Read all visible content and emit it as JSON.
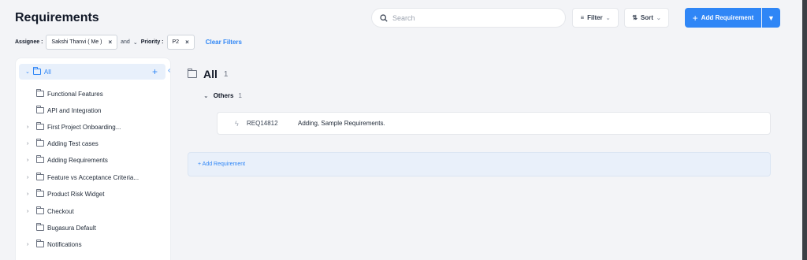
{
  "header": {
    "title": "Requirements",
    "search_placeholder": "Search",
    "filter_label": "Filter",
    "sort_label": "Sort",
    "add_requirement_label": "Add Requirement"
  },
  "filters": {
    "assignee_label": "Assignee :",
    "assignee_value": "Sakshi Thanvi ( Me )",
    "and_label": "and",
    "priority_label": "Priority :",
    "priority_value": "P2",
    "clear_label": "Clear Filters"
  },
  "sidebar": {
    "all_label": "All",
    "items": [
      {
        "label": "Functional Features",
        "expandable": false
      },
      {
        "label": "API and Integration",
        "expandable": false
      },
      {
        "label": "First Project Onboarding...",
        "expandable": true
      },
      {
        "label": "Adding Test cases",
        "expandable": true
      },
      {
        "label": "Adding Requirements",
        "expandable": true
      },
      {
        "label": "Feature vs Acceptance Criteria...",
        "expandable": true
      },
      {
        "label": "Product Risk Widget",
        "expandable": true
      },
      {
        "label": "Checkout",
        "expandable": true
      },
      {
        "label": "Bugasura Default",
        "expandable": false
      },
      {
        "label": "Notifications",
        "expandable": true
      }
    ]
  },
  "main": {
    "title": "All",
    "count": "1",
    "group": {
      "name": "Others",
      "count": "1"
    },
    "requirements": [
      {
        "id": "REQ14812",
        "title": "Adding, Sample Requirements."
      }
    ],
    "add_requirement_inline": "+ Add Requirement"
  },
  "colors": {
    "accent": "#2f86f6",
    "background": "#f3f4f7",
    "selected_bg": "#e8f0fb"
  }
}
